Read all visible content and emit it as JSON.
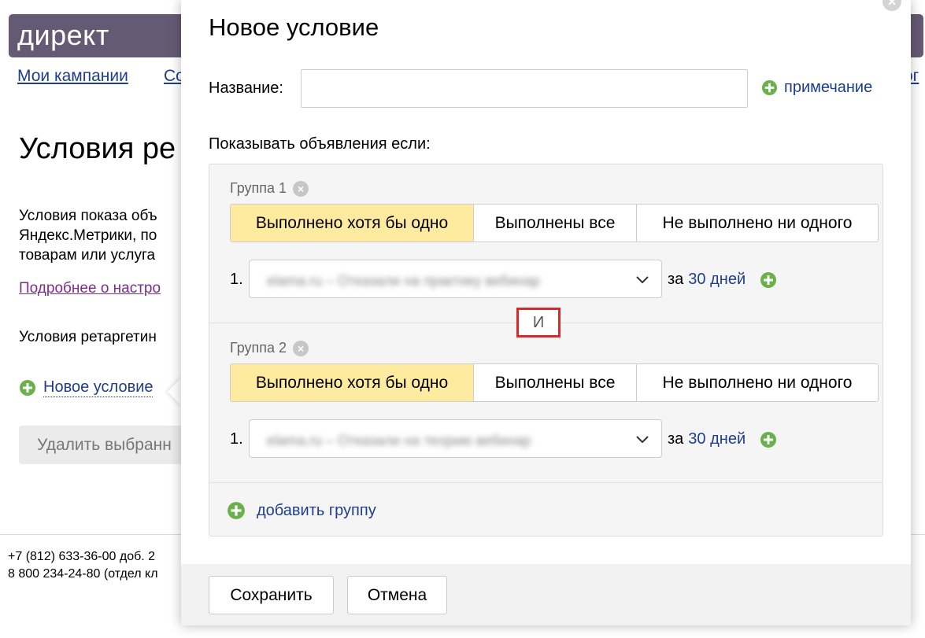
{
  "background": {
    "logo": "директ",
    "nav": {
      "campaigns": "Мои кампании",
      "second": "Со",
      "third": "ог"
    },
    "title": "Условия ре",
    "description": "Условия показа объ\nЯндекс.Метрики, по\nтоварам или услуга",
    "more_link": "Подробнее о настро",
    "retargeting": "Условия ретаргетин",
    "new_condition": "Новое условие",
    "delete_button": "Удалить выбранн",
    "phone1": "+7 (812) 633-36-00 доб. 2",
    "phone2": "8 800 234-24-80 (отдел кл"
  },
  "modal": {
    "title": "Новое условие",
    "name_label": "Название:",
    "name_value": "",
    "note_link": "примечание",
    "show_label": "Показывать объявления если:",
    "and_label": "И",
    "groups": [
      {
        "label": "Группа 1",
        "options": [
          "Выполнено хотя бы одно",
          "Выполнены все",
          "Не выполнено ни одного"
        ],
        "active": 0,
        "condition_number": "1.",
        "condition_value": "elama.ru – Отказали на практику вебинар",
        "period_prefix": "за",
        "period_value": "30 дней"
      },
      {
        "label": "Группа 2",
        "options": [
          "Выполнено хотя бы одно",
          "Выполнены все",
          "Не выполнено ни одного"
        ],
        "active": 0,
        "condition_number": "1.",
        "condition_value": "elama.ru – Отказали на теорию вебинар",
        "period_prefix": "за",
        "period_value": "30 дней"
      }
    ],
    "add_group": "добавить группу",
    "save_button": "Сохранить",
    "cancel_button": "Отмена"
  },
  "colors": {
    "header": "#655a73",
    "link": "#1f3d8a",
    "active_segment": "#ffeba0",
    "plus_green": "#6ab04c",
    "highlight_red": "#d42a2a"
  }
}
